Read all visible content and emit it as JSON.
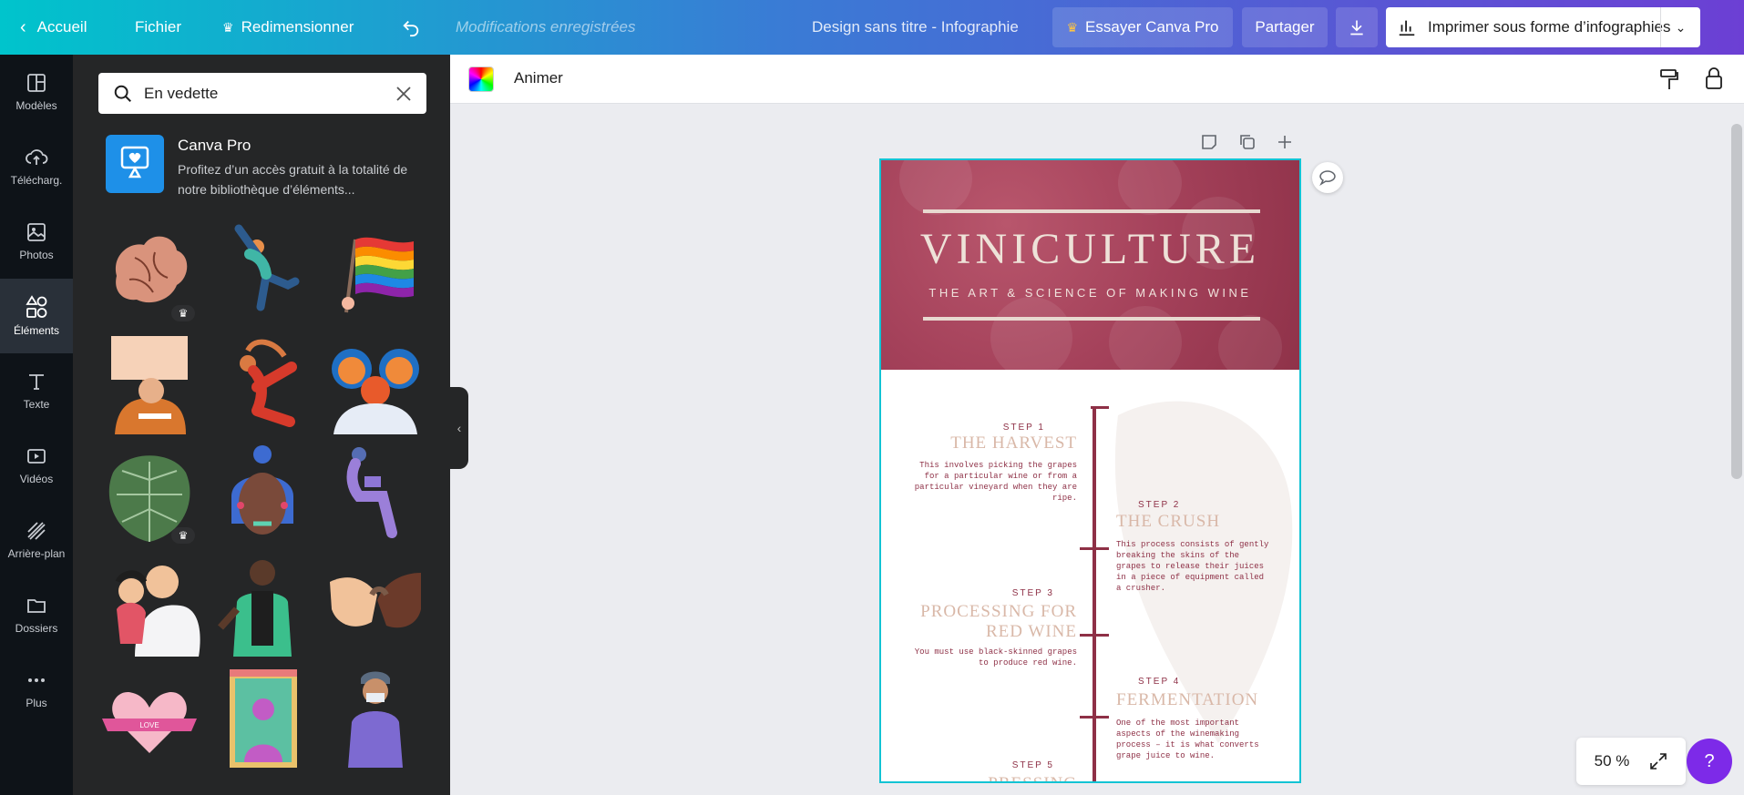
{
  "topbar": {
    "home": "Accueil",
    "file": "Fichier",
    "resize": "Redimensionner",
    "saved": "Modifications enregistrées",
    "doc_title": "Design sans titre - Infographie",
    "try_pro": "Essayer Canva Pro",
    "share": "Partager",
    "print": "Imprimer sous forme d’infographies"
  },
  "rail": {
    "items": [
      {
        "label": "Modèles",
        "icon": "templates-icon"
      },
      {
        "label": "Télécharg.",
        "icon": "upload-icon"
      },
      {
        "label": "Photos",
        "icon": "photos-icon"
      },
      {
        "label": "Éléments",
        "icon": "elements-icon"
      },
      {
        "label": "Texte",
        "icon": "text-icon"
      },
      {
        "label": "Vidéos",
        "icon": "video-icon"
      },
      {
        "label": "Arrière-plan",
        "icon": "background-icon"
      },
      {
        "label": "Dossiers",
        "icon": "folder-icon"
      },
      {
        "label": "Plus",
        "icon": "more-icon"
      }
    ]
  },
  "panel": {
    "search_value": "En vedette",
    "pro_title": "Canva Pro",
    "pro_desc": "Profitez d’un accès gratuit à la totalité de notre bibliothèque d’éléments..."
  },
  "ctxbar": {
    "animate": "Animer"
  },
  "infographic": {
    "title": "VINICULTURE",
    "subtitle": "THE ART & SCIENCE OF MAKING WINE",
    "steps": [
      {
        "label": "STEP 1",
        "title": "THE HARVEST",
        "desc": "This involves picking the grapes for a particular wine or from a particular vineyard when they are ripe."
      },
      {
        "label": "STEP 2",
        "title": "THE CRUSH",
        "desc": "This process consists of gently breaking the skins of the grapes to release their juices in a piece of equipment called a crusher."
      },
      {
        "label": "STEP 3",
        "title": "PROCESSING FOR RED WINE",
        "desc": "You must use black-skinned grapes to produce red wine."
      },
      {
        "label": "STEP 4",
        "title": "FERMENTATION",
        "desc": "One of the most important aspects of the winemaking process – it is what converts grape juice to wine."
      },
      {
        "label": "STEP 5",
        "title": "PRESSING",
        "desc": ""
      }
    ]
  },
  "zoom": "50 %",
  "help": "?",
  "colors": {
    "accent": "#8e3046",
    "selection": "#13c3d4",
    "pro": "#7d2ae8"
  }
}
